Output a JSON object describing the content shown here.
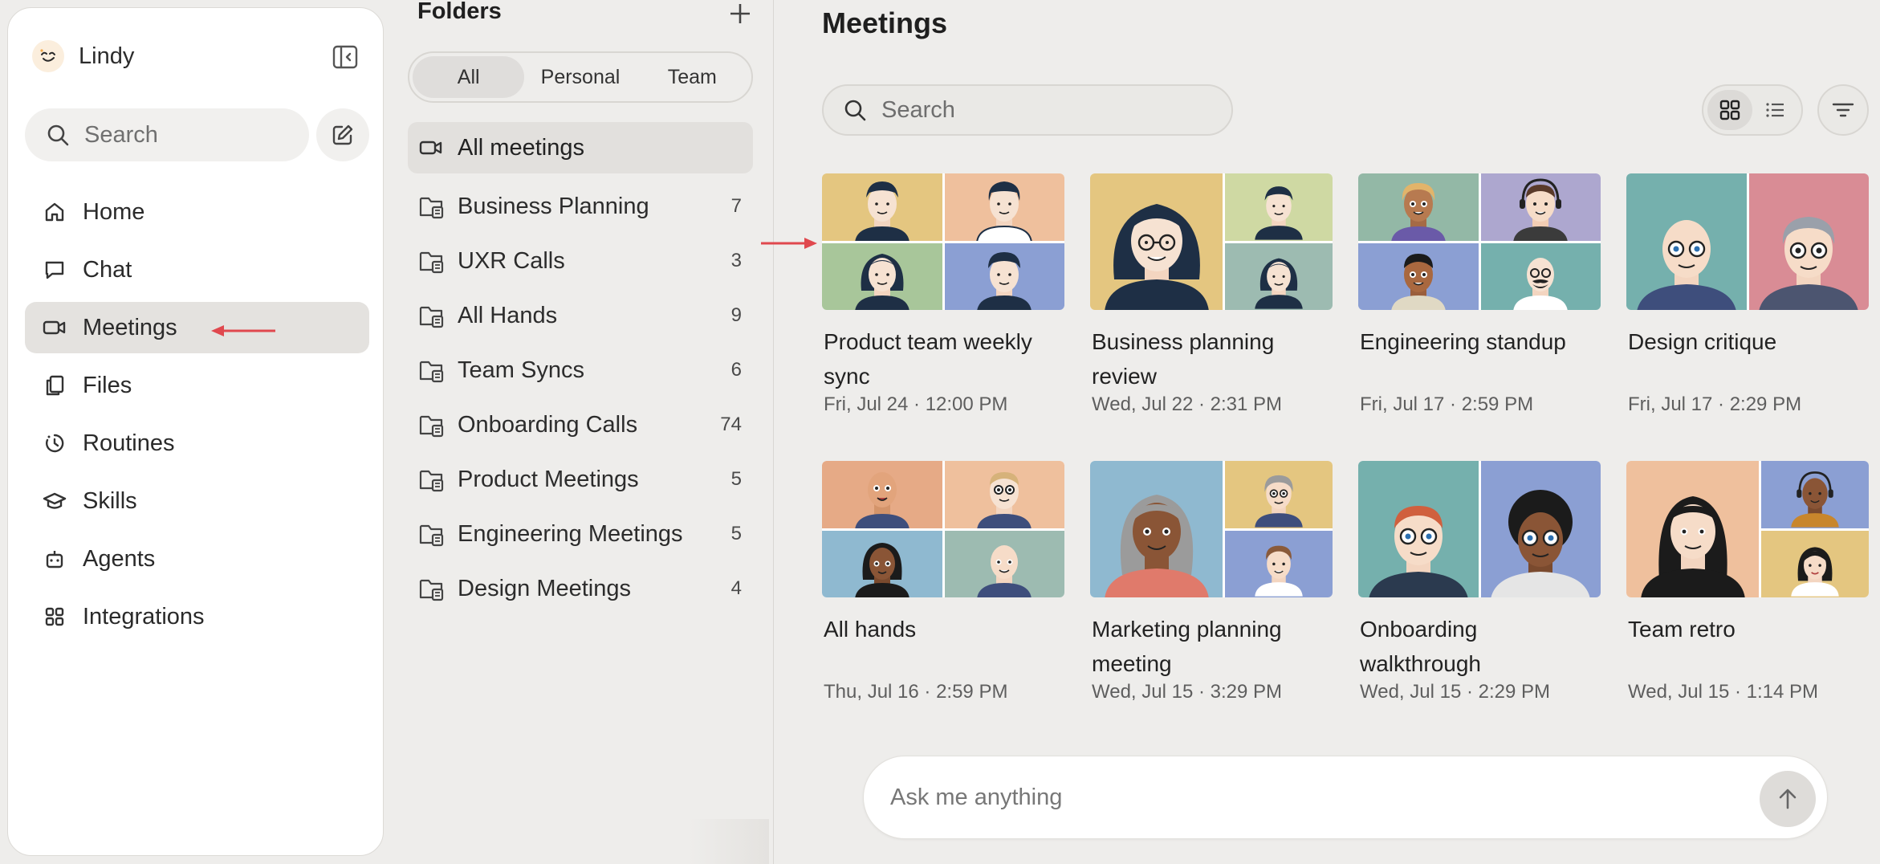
{
  "sidebar": {
    "brand": "Lindy",
    "search_placeholder": "Search",
    "items": [
      {
        "label": "Home",
        "icon": "home-icon"
      },
      {
        "label": "Chat",
        "icon": "chat-icon"
      },
      {
        "label": "Meetings",
        "icon": "video-icon",
        "active": true
      },
      {
        "label": "Files",
        "icon": "files-icon"
      },
      {
        "label": "Routines",
        "icon": "routines-icon"
      },
      {
        "label": "Skills",
        "icon": "skills-icon"
      },
      {
        "label": "Agents",
        "icon": "agents-icon"
      },
      {
        "label": "Integrations",
        "icon": "integrations-icon"
      }
    ]
  },
  "folders": {
    "title": "Folders",
    "tabs": [
      "All",
      "Personal",
      "Team"
    ],
    "active_tab": "All",
    "all_meetings": "All meetings",
    "items": [
      {
        "name": "Business Planning",
        "count": "7"
      },
      {
        "name": "UXR Calls",
        "count": "3"
      },
      {
        "name": "All Hands",
        "count": "9"
      },
      {
        "name": "Team Syncs",
        "count": "6"
      },
      {
        "name": "Onboarding Calls",
        "count": "74"
      },
      {
        "name": "Product Meetings",
        "count": "5"
      },
      {
        "name": "Engineering Meetings",
        "count": "5"
      },
      {
        "name": "Design Meetings",
        "count": "4"
      }
    ]
  },
  "main": {
    "title": "Meetings",
    "search_placeholder": "Search",
    "meetings": [
      {
        "title": "Product team weekly sync",
        "date": "Fri, Jul 24 · 12:00 PM"
      },
      {
        "title": "Business planning review",
        "date": "Wed, Jul 22 · 2:31 PM"
      },
      {
        "title": "Engineering standup",
        "date": "Fri, Jul 17 · 2:59 PM"
      },
      {
        "title": "Design critique",
        "date": "Fri, Jul 17 · 2:29 PM"
      },
      {
        "title": "All hands",
        "date": "Thu, Jul 16 · 2:59 PM"
      },
      {
        "title": "Marketing planning meeting",
        "date": "Wed, Jul 15 · 3:29 PM"
      },
      {
        "title": "Onboarding walkthrough",
        "date": "Wed, Jul 15 · 2:29 PM"
      },
      {
        "title": "Team retro",
        "date": "Wed, Jul 15 · 1:14 PM"
      }
    ]
  },
  "ask_bar": {
    "placeholder": "Ask me anything"
  },
  "colors": {
    "background": "#eeedeb",
    "active_nav": "#e4e2df",
    "annotation_arrow": "#e0484e"
  }
}
